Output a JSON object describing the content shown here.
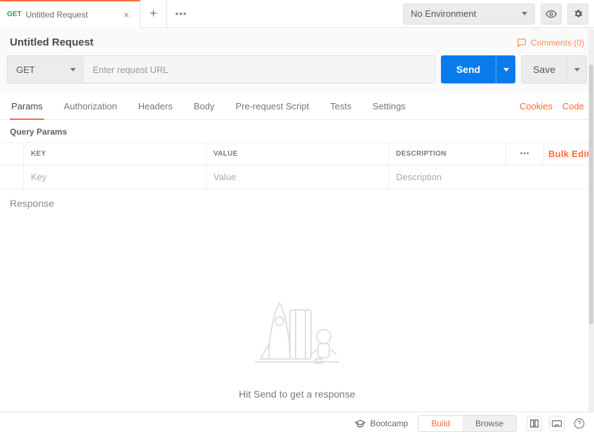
{
  "topbar": {
    "tab_method": "GET",
    "tab_title": "Untitled Request",
    "environment": "No Environment"
  },
  "request": {
    "title": "Untitled Request",
    "comments_label": "Comments (0)",
    "method": "GET",
    "url_placeholder": "Enter request URL",
    "send_label": "Send",
    "save_label": "Save"
  },
  "tabs": {
    "items": [
      "Params",
      "Authorization",
      "Headers",
      "Body",
      "Pre-request Script",
      "Tests",
      "Settings"
    ],
    "cookies": "Cookies",
    "code": "Code"
  },
  "params": {
    "section": "Query Params",
    "head_key": "KEY",
    "head_value": "VALUE",
    "head_desc": "DESCRIPTION",
    "bulk_edit": "Bulk Edit",
    "ph_key": "Key",
    "ph_value": "Value",
    "ph_desc": "Description"
  },
  "response": {
    "label": "Response",
    "empty_text": "Hit Send to get a response"
  },
  "bottom": {
    "bootcamp": "Bootcamp",
    "build": "Build",
    "browse": "Browse"
  }
}
